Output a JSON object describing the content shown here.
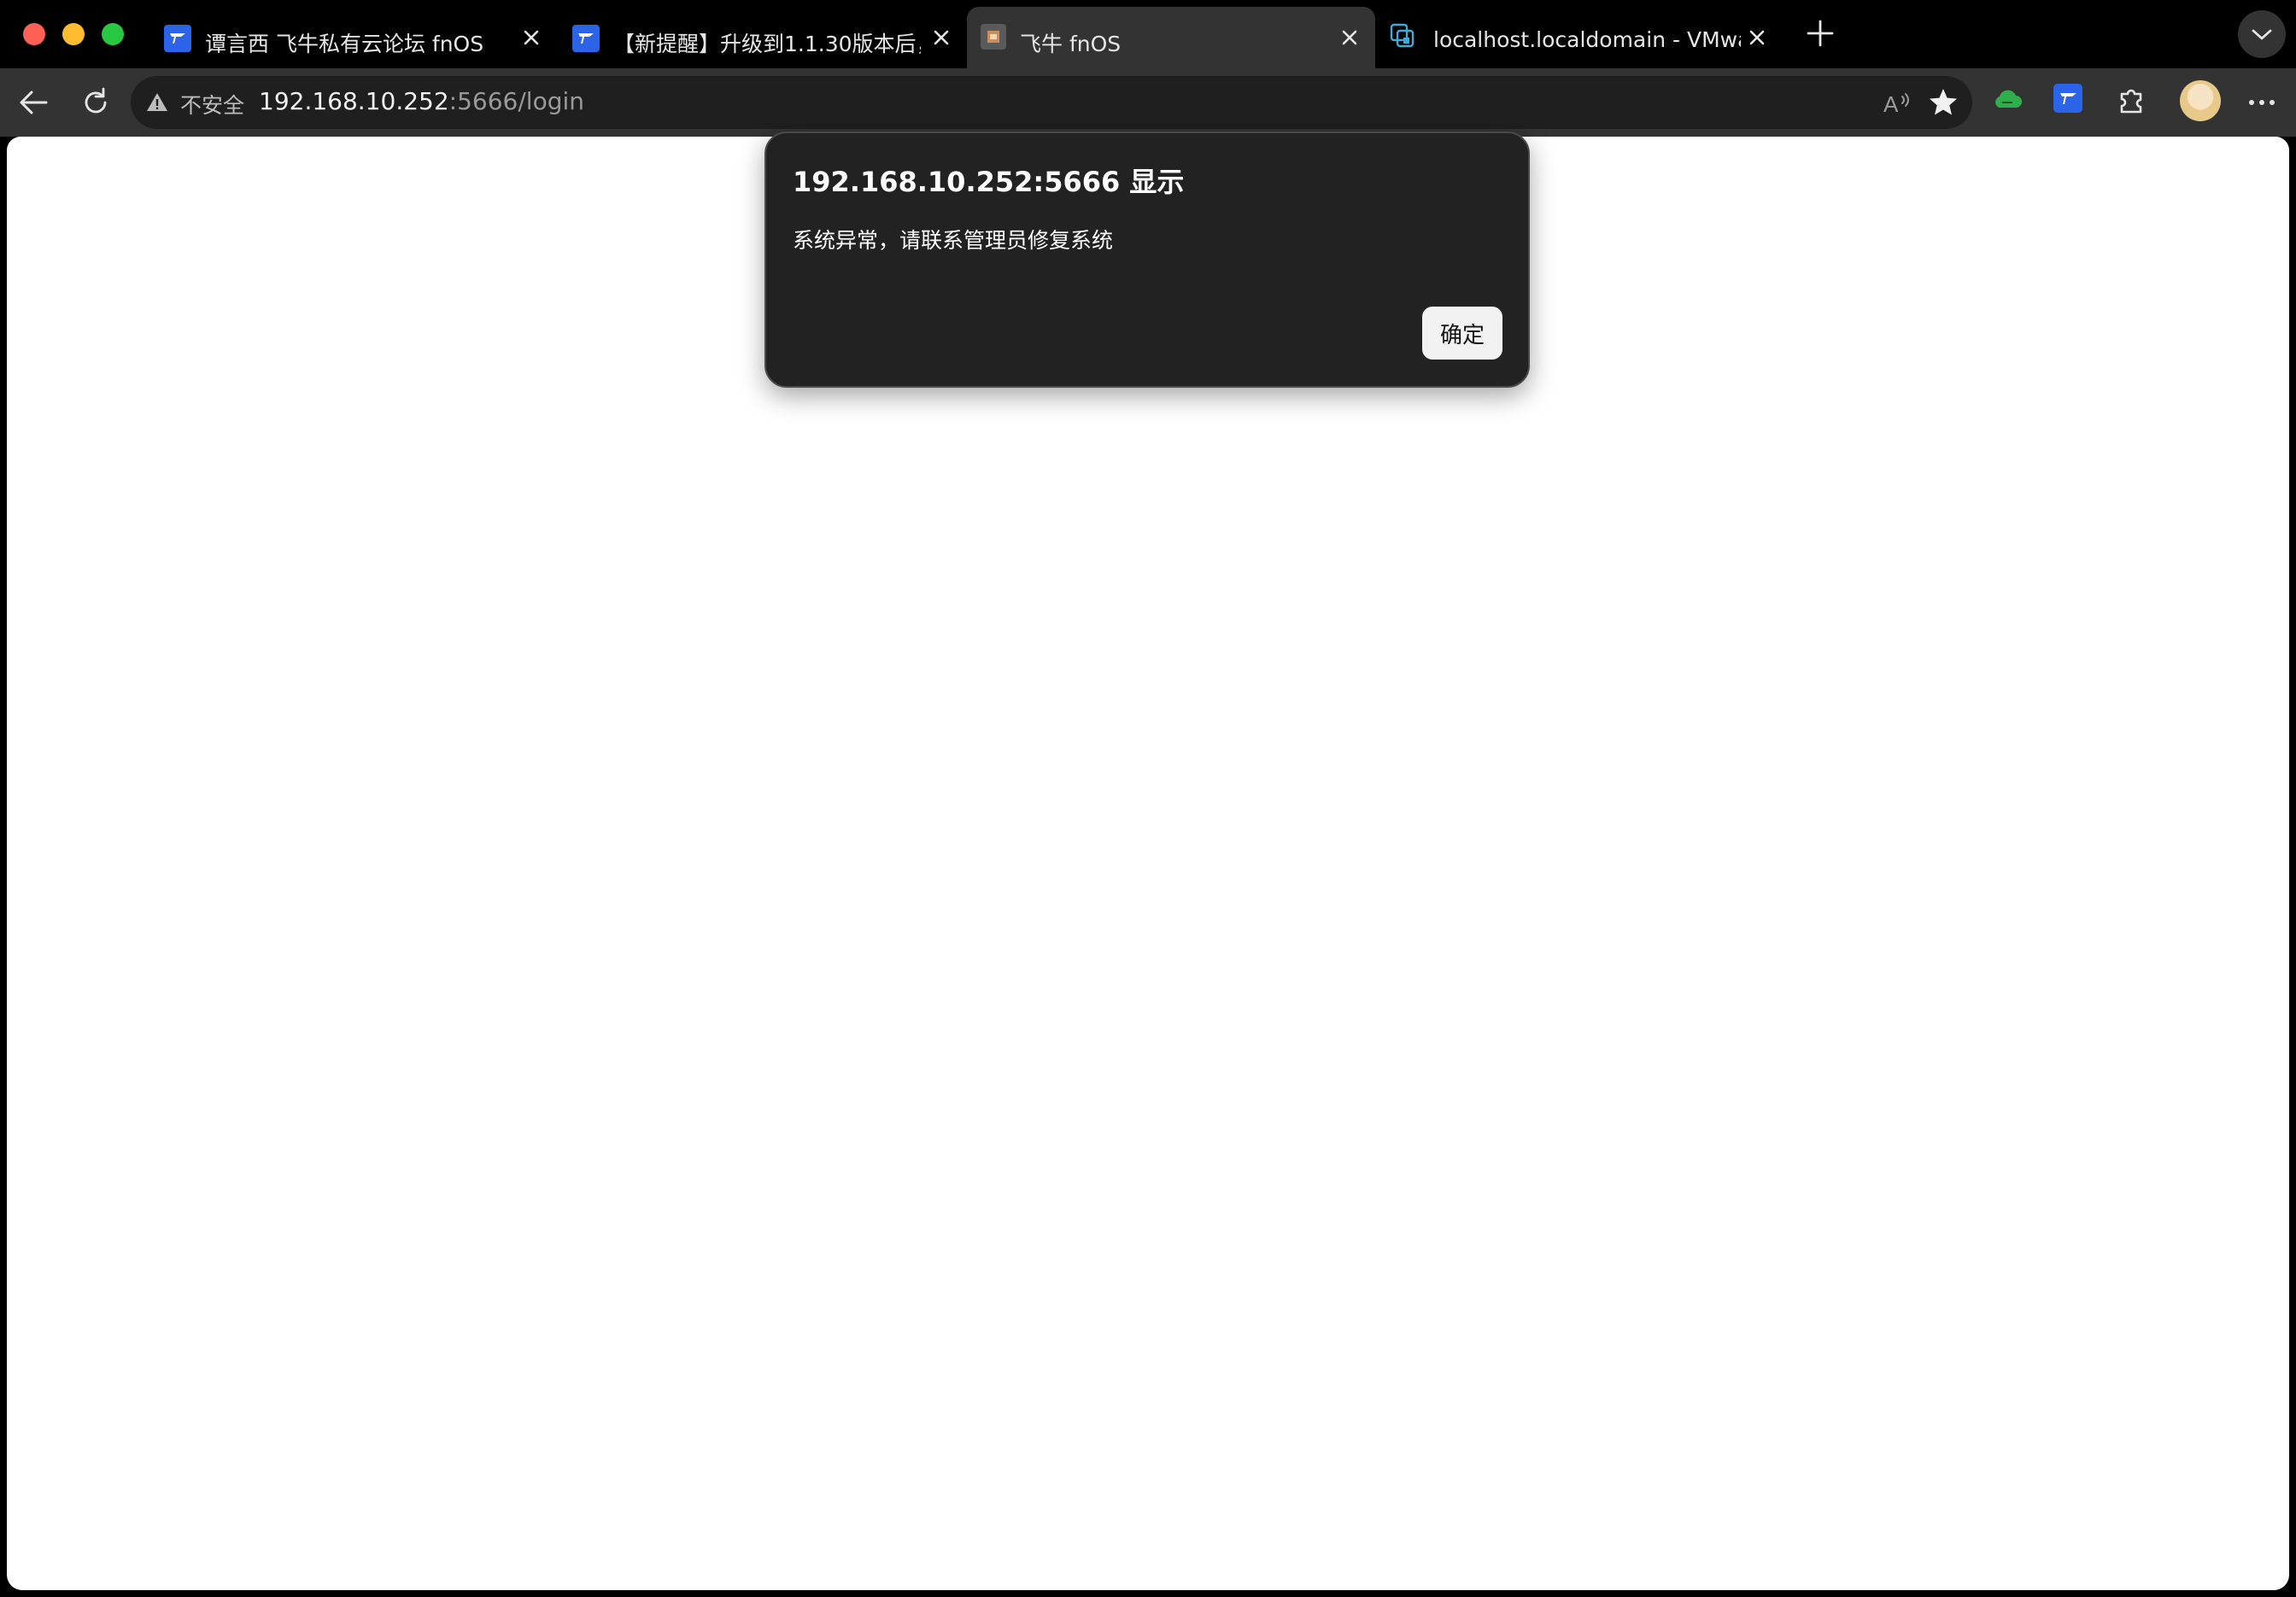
{
  "tabs": [
    {
      "title": "谭言西 飞牛私有云论坛 fnOS",
      "favicon": "fnos-forum-icon",
      "active": false
    },
    {
      "title": "【新提醒】升级到1.1.30版本后，",
      "favicon": "fnos-forum-icon",
      "active": false
    },
    {
      "title": "飞牛 fnOS",
      "favicon": "fnos-page-icon",
      "active": true
    },
    {
      "title": "localhost.localdomain - VMware",
      "favicon": "vmware-icon",
      "active": false
    }
  ],
  "toolbar": {
    "security_label": "不安全",
    "url_host": "192.168.10.252",
    "url_rest": ":5666/login"
  },
  "dialog": {
    "title": "192.168.10.252:5666 显示",
    "message": "系统异常，请联系管理员修复系统",
    "ok_label": "确定"
  },
  "colors": {
    "tabstrip": "#000000",
    "toolbar": "#333333",
    "omnibox": "#1f1f1f",
    "dialog_bg": "#222222",
    "favicon_blue": "#2b64e8",
    "traffic_red": "#fe5f57",
    "traffic_yellow": "#febc2e",
    "traffic_green": "#28c840"
  }
}
